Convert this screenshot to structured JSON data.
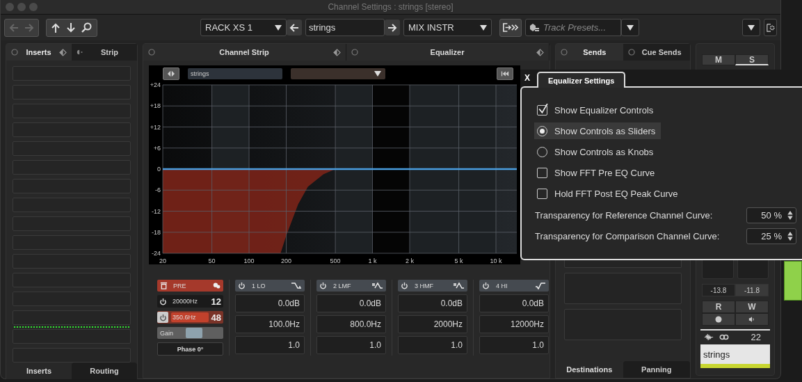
{
  "window": {
    "title": "Channel Settings : strings [stereo]"
  },
  "toolbar": {
    "rack": "RACK XS 1",
    "track_name": "strings",
    "output": "MIX INSTR",
    "presets_placeholder": "Track Presets..."
  },
  "inserts_panel": {
    "tabs": [
      {
        "label": "Inserts",
        "selected": true
      },
      {
        "label": "Strip",
        "selected": false
      }
    ],
    "bottom_tabs": [
      {
        "label": "Inserts",
        "selected": true
      },
      {
        "label": "Routing",
        "selected": false
      }
    ]
  },
  "channel_strip": {
    "title": "Channel Strip"
  },
  "equalizer": {
    "title": "Equalizer",
    "preset": "strings",
    "db_labels": [
      "+24",
      "+18",
      "+12",
      "+6",
      "0",
      "-6",
      "-12",
      "-18",
      "-24"
    ],
    "frequency_labels": [
      "20",
      "50",
      "100",
      "200",
      "500",
      "1 k",
      "2 k",
      "5 k",
      "10 k"
    ],
    "pre": {
      "label": "PRE",
      "filters": [
        {
          "on": false,
          "frequency": "20000Hz",
          "slope": "12"
        },
        {
          "on": true,
          "frequency": "350.6Hz",
          "slope": "48"
        }
      ],
      "gain": {
        "label": "Gain",
        "level": 0.6
      },
      "phase": "Phase 0°"
    },
    "bands": [
      {
        "name": "1 LO",
        "kind": "low-shelf",
        "on": false,
        "gain": "0.0dB",
        "frequency": "100.0Hz",
        "q": "1.0"
      },
      {
        "name": "2 LMF",
        "kind": "peak",
        "on": false,
        "gain": "0.0dB",
        "frequency": "800.0Hz",
        "q": "1.0"
      },
      {
        "name": "3 HMF",
        "kind": "peak",
        "on": false,
        "gain": "0.0dB",
        "frequency": "2000Hz",
        "q": "1.0"
      },
      {
        "name": "4 HI",
        "kind": "high-shelf",
        "on": false,
        "gain": "0.0dB",
        "frequency": "12000Hz",
        "q": "1.0"
      }
    ]
  },
  "sends_panel": {
    "tabs": [
      {
        "label": "Sends",
        "selected": true
      },
      {
        "label": "Cue Sends",
        "selected": false
      }
    ],
    "bottom_tabs": [
      {
        "label": "Destinations",
        "selected": true
      },
      {
        "label": "Panning",
        "selected": false
      }
    ]
  },
  "fader_strip": {
    "mute": "M",
    "solo": "S",
    "levels": [
      "-13.8",
      "-11.8"
    ],
    "read": "R",
    "write": "W",
    "channel_number": "22",
    "name": "strings",
    "color": "#c8d630"
  },
  "popup": {
    "close": "X",
    "tab": "Equalizer Settings",
    "options": [
      {
        "kind": "checkbox",
        "label": "Show Equalizer Controls",
        "checked": true
      },
      {
        "kind": "radio",
        "label": "Show Controls as Sliders",
        "selected": true
      },
      {
        "kind": "radio",
        "label": "Show Controls as Knobs",
        "selected": false
      },
      {
        "kind": "checkbox",
        "label": "Show FFT Pre EQ Curve",
        "checked": false
      },
      {
        "kind": "checkbox",
        "label": "Hold FFT Post EQ Peak Curve",
        "checked": false
      }
    ],
    "spinners": [
      {
        "label": "Transparency for Reference Channel Curve:",
        "value": "50 %"
      },
      {
        "label": "Transparency for Comparison Channel Curve:",
        "value": "25 %"
      }
    ]
  }
}
